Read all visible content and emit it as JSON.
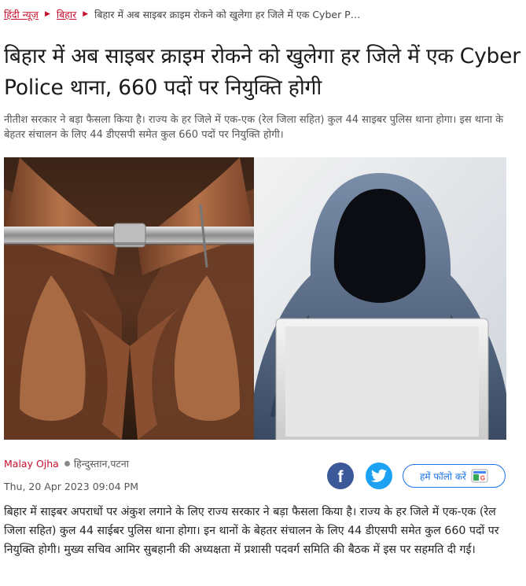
{
  "breadcrumb": {
    "home": "हिंदी न्यूज़",
    "section": "बिहार",
    "current": "बिहार में अब साइबर क्राइम रोकने को खुलेगा हर जिले में एक Cyber P…"
  },
  "article": {
    "headline": "बिहार में अब साइबर क्राइम रोकने को खुलेगा हर जिले में एक Cyber Police थाना, 660 पदों पर नियुक्ति होगी",
    "summary": "नीतीश सरकार ने बड़ा फैसला किया है। राज्य के हर जिले में एक-एक (रेल जिला सहित) कुल 44 साइबर पुलिस थाना होगा। इस थाना के बेहतर संचालन के लिए 44 डीएसपी समेत कुल 660 पदों पर नियुक्ति होगी।",
    "author": "Malay Ojha",
    "source": "हिन्दुस्तान,पटना",
    "date": "Thu, 20 Apr 2023 09:04 PM",
    "body": "बिहार में साइबर अपराधों पर अंकुश लगाने के लिए राज्य सरकार ने बड़ा फैसला किया है। राज्य के हर जिले में एक-एक (रेल जिला सहित) कुल 44 साईबर पुलिस थाना होगा। इन थानों के बेहतर संचालन के लिए 44 डीएसपी समेत कुल 660 पदों पर नियुक्ति होगी। मुख्य सचिव आमिर सुबहानी की अध्यक्षता में प्रशासी पदवर्ग समिति की बैठक में इस पर सहमति दी गई।"
  },
  "share": {
    "follow_label": "हमें फॉलो करें",
    "follow_icon": "google-news-icon",
    "facebook_icon": "facebook-icon",
    "twitter_icon": "twitter-icon"
  },
  "colors": {
    "accent": "#c8102e",
    "facebook": "#3b5998",
    "twitter": "#1da1f2",
    "follow": "#1a73e8"
  }
}
